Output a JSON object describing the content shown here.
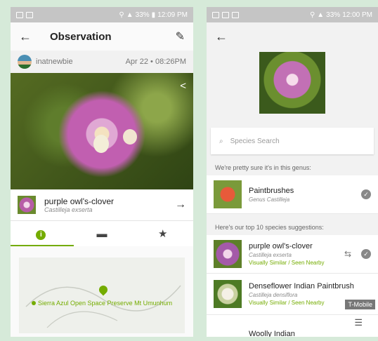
{
  "phone1": {
    "status": {
      "battery": "33%",
      "time": "12:09 PM"
    },
    "title": "Observation",
    "user": {
      "name": "inatnewbie",
      "date": "Apr 22 • 08:26PM"
    },
    "species": {
      "common": "purple owl's-clover",
      "scientific": "Castilleja exserta"
    },
    "map_label": "Sierra Azul Open Space Preserve Mt Umunhum",
    "icons": {
      "back": "arrow-left-icon",
      "edit": "pencil-icon",
      "share": "share-icon",
      "next": "arrow-right-icon",
      "info": "info-icon",
      "comments": "comment-icon",
      "favorite": "star-icon"
    },
    "accent": "#74ac00"
  },
  "phone2": {
    "status": {
      "battery": "33%",
      "time": "12:00 PM"
    },
    "search_placeholder": "Species Search",
    "genus_header": "We're pretty sure it's in this genus:",
    "genus": {
      "common": "Paintbrushes",
      "scientific": "Genus Castilleja"
    },
    "top_header": "Here's our top 10 species suggestions:",
    "suggestions": [
      {
        "common": "purple owl's-clover",
        "scientific": "Castilleja exserta",
        "note": "Visually Similar / Seen Nearby"
      },
      {
        "common": "Denseflower Indian Paintbrush",
        "scientific": "Castilleja densiflora",
        "note": "Visually Similar / Seen Nearby"
      },
      {
        "common": "Woolly Indian",
        "scientific": "",
        "note": ""
      }
    ],
    "carrier_tag": "T-Mobile"
  }
}
